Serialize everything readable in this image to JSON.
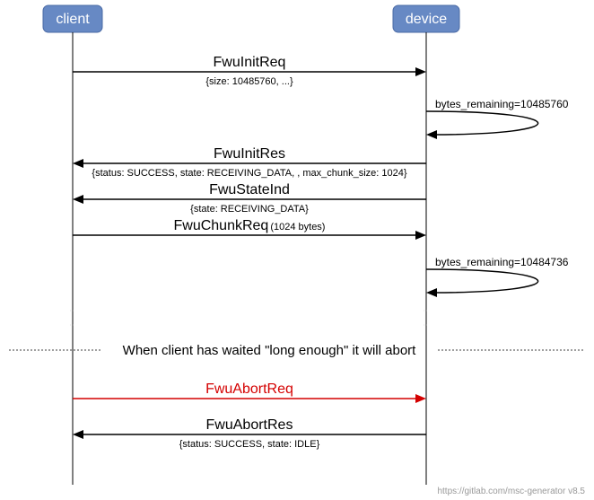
{
  "actors": {
    "client": "client",
    "device": "device"
  },
  "messages": {
    "m1_label": "FwuInitReq",
    "m1_sub": "{size: 10485760, ...}",
    "self1": "bytes_remaining=10485760",
    "m2_label": "FwuInitRes",
    "m2_sub": "{status: SUCCESS, state: RECEIVING_DATA, , max_chunk_size: 1024}",
    "m3_label": "FwuStateInd",
    "m3_sub": "{state: RECEIVING_DATA}",
    "m4_label": "FwuChunkReq",
    "m4_suffix": "(1024 bytes)",
    "self2": "bytes_remaining=10484736",
    "sep": "When client has waited \"long enough\" it will abort",
    "m5_label": "FwuAbortReq",
    "m6_label": "FwuAbortRes",
    "m6_sub": "{status: SUCCESS, state: IDLE}"
  },
  "credit": "https://gitlab.com/msc-generator v8.5"
}
